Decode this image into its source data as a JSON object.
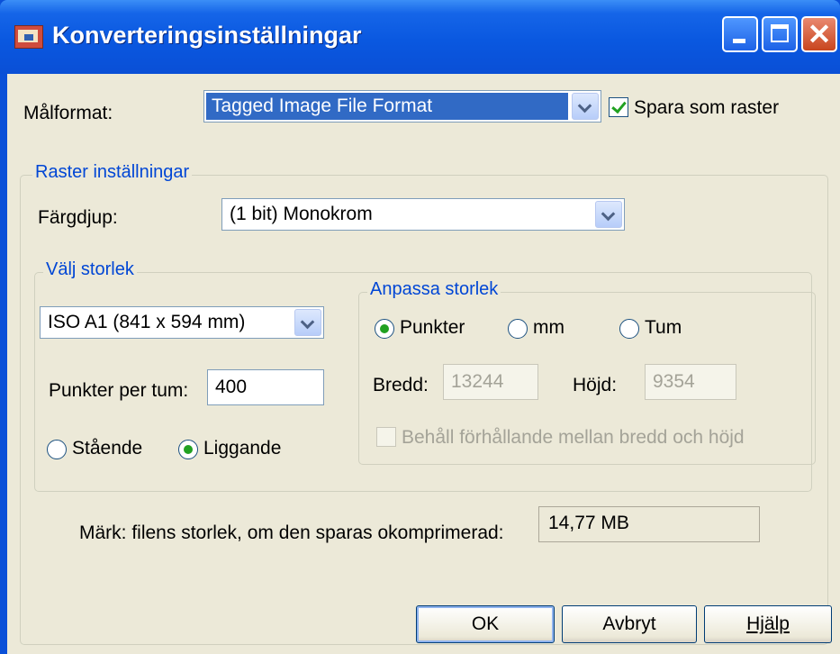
{
  "window": {
    "title": "Konverteringsinställningar",
    "close_glyph": "✕"
  },
  "target": {
    "label": "Målformat:",
    "value": "Tagged Image File Format",
    "raster_checkbox_label": "Spara som raster",
    "raster_checked": true
  },
  "raster": {
    "group_title": "Raster inställningar",
    "color_depth_label": "Färgdjup:",
    "color_depth_value": "(1 bit) Monokrom"
  },
  "size": {
    "group_title": "Välj storlek",
    "paper_value": "ISO A1 (841 x 594 mm)",
    "dpi_label": "Punkter per tum:",
    "dpi_value": "400",
    "orientation": {
      "portrait_label": "Stående",
      "landscape_label": "Liggande",
      "selected": "Liggande"
    }
  },
  "custom": {
    "group_title": "Anpassa storlek",
    "units": [
      "Punkter",
      "mm",
      "Tum"
    ],
    "selected_unit": "Punkter",
    "width_label": "Bredd:",
    "width_value": "13244",
    "height_label": "Höjd:",
    "height_value": "9354",
    "keep_ratio_label": "Behåll förhållande mellan bredd och höjd"
  },
  "note": {
    "label": "Märk: filens storlek, om den sparas okomprimerad:",
    "value": "14,77 MB"
  },
  "buttons": {
    "ok": "OK",
    "cancel": "Avbryt",
    "help": "Hjälp"
  },
  "colors": {
    "titlebar": "#0a58e0",
    "client": "#ece9d8",
    "group_title": "#0046d5",
    "selection": "#316ac5",
    "radio_dot": "#21a121"
  }
}
